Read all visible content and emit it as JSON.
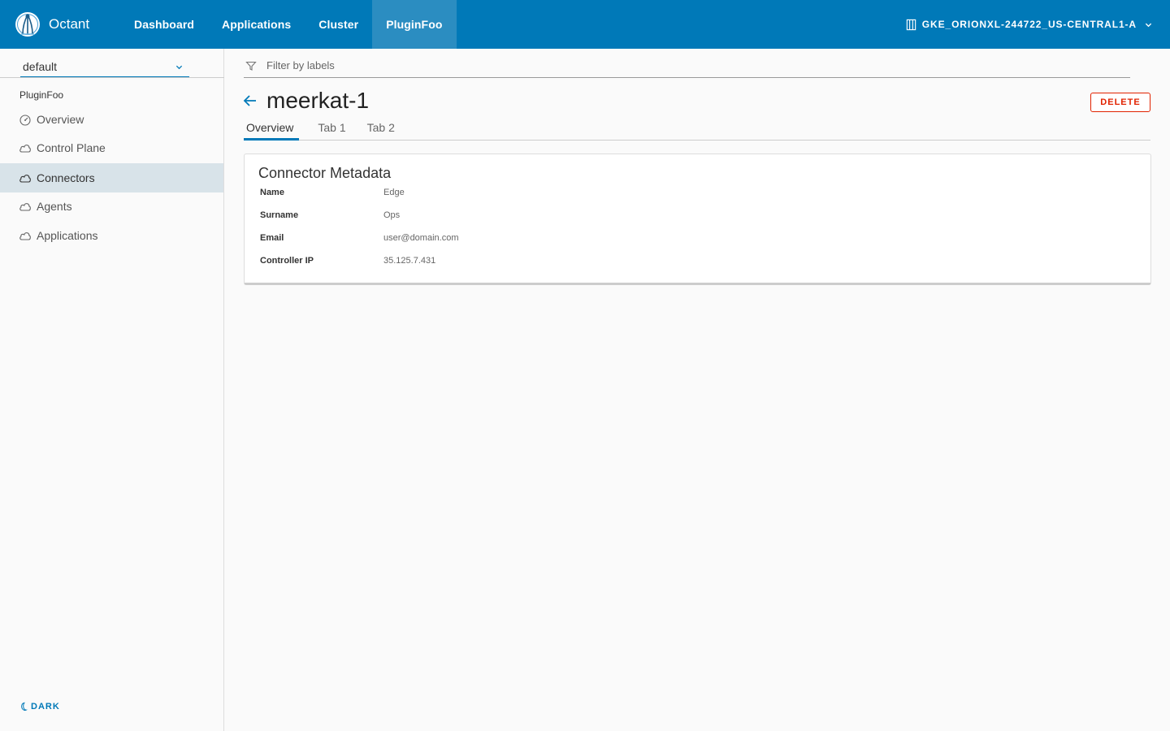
{
  "app": {
    "brand_name": "Octant",
    "colors": {
      "primary": "#0079b8",
      "nav_active": "#2b8dc1",
      "danger": "#e12200",
      "sidebar_active": "#d8e3e9"
    }
  },
  "nav": {
    "items": [
      {
        "label": "Dashboard",
        "active": false
      },
      {
        "label": "Applications",
        "active": false
      },
      {
        "label": "Cluster",
        "active": false
      },
      {
        "label": "PluginFoo",
        "active": true
      }
    ],
    "context": {
      "label": "GKE_ORIONXL-244722_US-CENTRAL1-A",
      "icon": "cluster-icon"
    }
  },
  "sidebar": {
    "namespace": "default",
    "section_title": "PluginFoo",
    "items": [
      {
        "label": "Overview",
        "icon": "dashboard-icon",
        "active": false
      },
      {
        "label": "Control Plane",
        "icon": "cloud-icon",
        "active": false
      },
      {
        "label": "Connectors",
        "icon": "cloud-icon",
        "active": true
      },
      {
        "label": "Agents",
        "icon": "cloud-icon",
        "active": false
      },
      {
        "label": "Applications",
        "icon": "cloud-icon",
        "active": false
      }
    ],
    "theme_toggle": "DARK"
  },
  "filter": {
    "placeholder": "Filter by labels"
  },
  "page": {
    "title": "meerkat-1",
    "delete_label": "DELETE",
    "tabs": [
      {
        "label": "Overview",
        "active": true
      },
      {
        "label": "Tab 1",
        "active": false
      },
      {
        "label": "Tab 2",
        "active": false
      }
    ]
  },
  "card": {
    "title": "Connector Metadata",
    "rows": [
      {
        "key": "Name",
        "value": "Edge"
      },
      {
        "key": "Surname",
        "value": "Ops"
      },
      {
        "key": "Email",
        "value": "user@domain.com"
      },
      {
        "key": "Controller IP",
        "value": "35.125.7.431"
      }
    ]
  }
}
